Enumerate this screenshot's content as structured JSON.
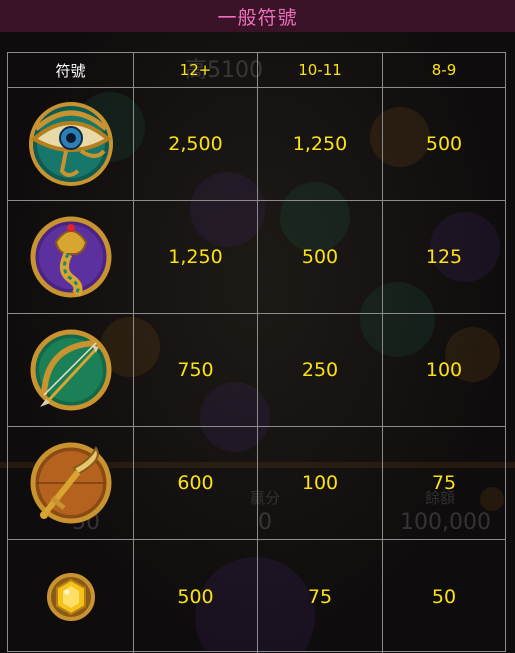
{
  "header": {
    "title": "一般符號"
  },
  "table": {
    "columns": [
      "符號",
      "12+",
      "10-11",
      "8-9"
    ],
    "rows": [
      {
        "symbol": "eye-of-horus-icon",
        "values": [
          "2,500",
          "1,250",
          "500"
        ]
      },
      {
        "symbol": "cobra-icon",
        "values": [
          "1,250",
          "500",
          "125"
        ]
      },
      {
        "symbol": "bow-arrow-icon",
        "values": [
          "750",
          "250",
          "100"
        ]
      },
      {
        "symbol": "khopesh-sword-icon",
        "values": [
          "600",
          "100",
          "75"
        ]
      },
      {
        "symbol": "gold-gem-icon",
        "values": [
          "500",
          "75",
          "50"
        ]
      }
    ]
  },
  "background": {
    "win_text": "贏分",
    "win_value": "0",
    "balance_text": "餘額",
    "balance_value": "100,000",
    "bet_value": "50",
    "top_faint": "高5100"
  },
  "colors": {
    "header_bg": "#3a1329",
    "header_text": "#f06fbb",
    "value": "#fbe214",
    "grid": "#8c8c8c"
  }
}
